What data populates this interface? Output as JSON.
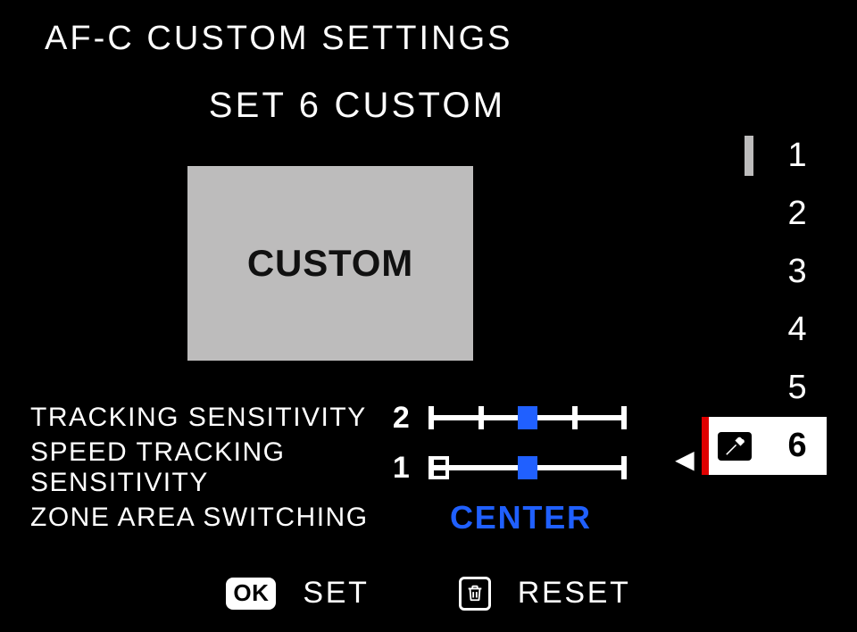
{
  "header": {
    "title": "AF-C CUSTOM SETTINGS"
  },
  "subtitle": "SET 6 CUSTOM",
  "preview": {
    "label": "CUSTOM"
  },
  "settings": {
    "tracking_sensitivity": {
      "label": "TRACKING SENSITIVITY",
      "value": "2",
      "slider": {
        "min": 0,
        "max": 4,
        "position": 2,
        "ticks": [
          1,
          3
        ]
      }
    },
    "speed_tracking_sensitivity": {
      "label": "SPEED TRACKING SENSITIVITY",
      "value": "1",
      "slider": {
        "min": 0,
        "max": 2,
        "position": 1,
        "outline_at": 0
      }
    },
    "zone_area_switching": {
      "label": "ZONE AREA SWITCHING",
      "value": "CENTER"
    }
  },
  "presets": {
    "items": [
      "1",
      "2",
      "3",
      "4",
      "5",
      "6"
    ],
    "active_index": 5,
    "active_icon": "wrench-icon",
    "scroll_indicator_index": 0
  },
  "footer": {
    "ok_label": "OK",
    "set_label": "SET",
    "trash_icon": "trash-icon",
    "reset_label": "RESET"
  },
  "colors": {
    "accent_blue": "#2060ff",
    "accent_red": "#e00000",
    "card_grey": "#bdbcbc"
  }
}
